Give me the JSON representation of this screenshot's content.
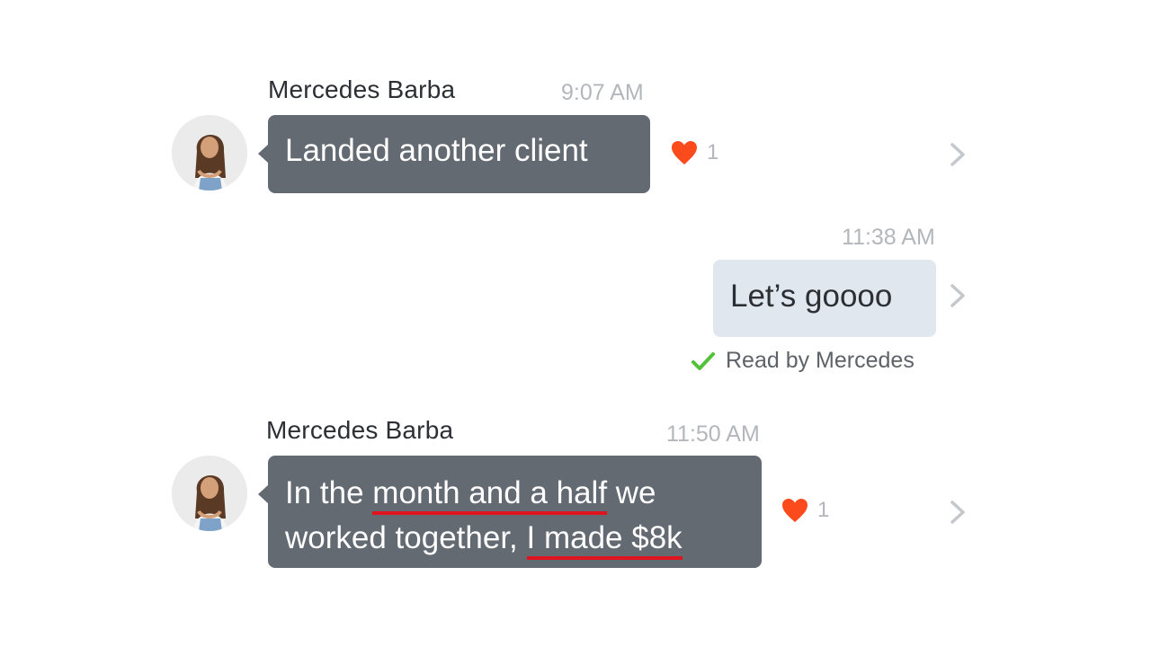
{
  "messages": [
    {
      "sender": "Mercedes Barba",
      "time": "9:07 AM",
      "text": "Landed another client",
      "reaction_count": "1"
    },
    {
      "time": "11:38 AM",
      "text": "Let’s goooo",
      "read_status": "Read by Mercedes"
    },
    {
      "sender": "Mercedes Barba",
      "time": "11:50 AM",
      "text_line1_a": "In the ",
      "text_line1_b": "month and a half",
      "text_line1_c": " we",
      "text_line2_a": "worked together, ",
      "text_line2_b": "I made $8k",
      "reaction_count": "1"
    }
  ],
  "icons": {
    "reaction": "heart-icon",
    "details": "chevron-right-icon",
    "read": "checkmark-icon",
    "avatar": "avatar"
  },
  "colors": {
    "incoming_bubble": "#636a72",
    "outgoing_bubble": "#e1e7ef",
    "heart": "#fb4a1c",
    "check": "#52c23a",
    "underline": "#e0141e"
  }
}
